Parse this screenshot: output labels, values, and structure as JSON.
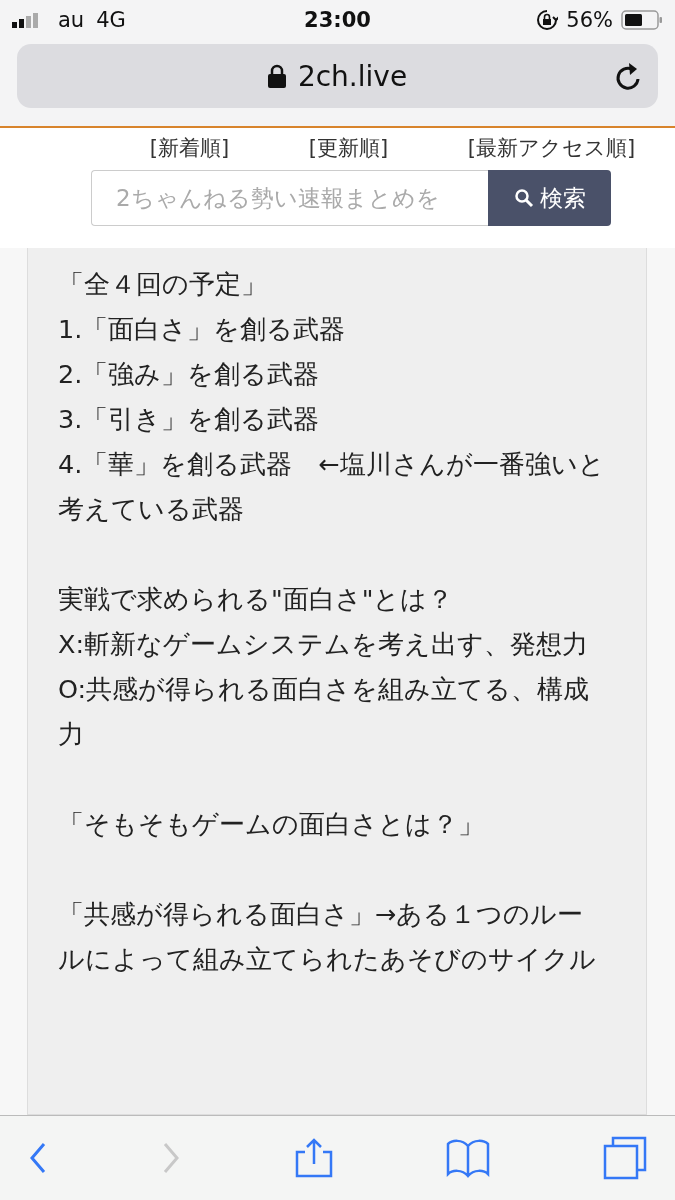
{
  "status_bar": {
    "carrier": "au",
    "network": "4G",
    "time": "23:00",
    "battery": "56%"
  },
  "address_bar": {
    "url": "2ch.live"
  },
  "site_header": {
    "sort_links": [
      "[新着順]",
      "[更新順]",
      "[最新アクセス順]"
    ],
    "search": {
      "placeholder": "2ちゃんねる勢い速報まとめを",
      "button": "検索"
    }
  },
  "post": {
    "paragraphs": [
      [
        "「全４回の予定」",
        "1.「面白さ」を創る武器",
        "2.「強み」を創る武器",
        "3.「引き」を創る武器",
        "4.「華」を創る武器　←塩川さんが一番強いと考えている武器"
      ],
      [
        "実戦で求められる\"面白さ\"とは？",
        "X:斬新なゲームシステムを考え出す、発想力",
        "O:共感が得られる面白さを組み立てる、構成力"
      ],
      [
        "「そもそもゲームの面白さとは？」"
      ],
      [
        "「共感が得られる面白さ」→ある１つのルールによって組み立てられたあそびのサイクル"
      ]
    ]
  },
  "toolbar": {
    "buttons": [
      {
        "kind": "back",
        "disabled": false
      },
      {
        "kind": "forward",
        "disabled": true
      },
      {
        "kind": "share",
        "disabled": false
      },
      {
        "kind": "bookmarks",
        "disabled": false
      },
      {
        "kind": "tabs",
        "disabled": false
      }
    ]
  }
}
